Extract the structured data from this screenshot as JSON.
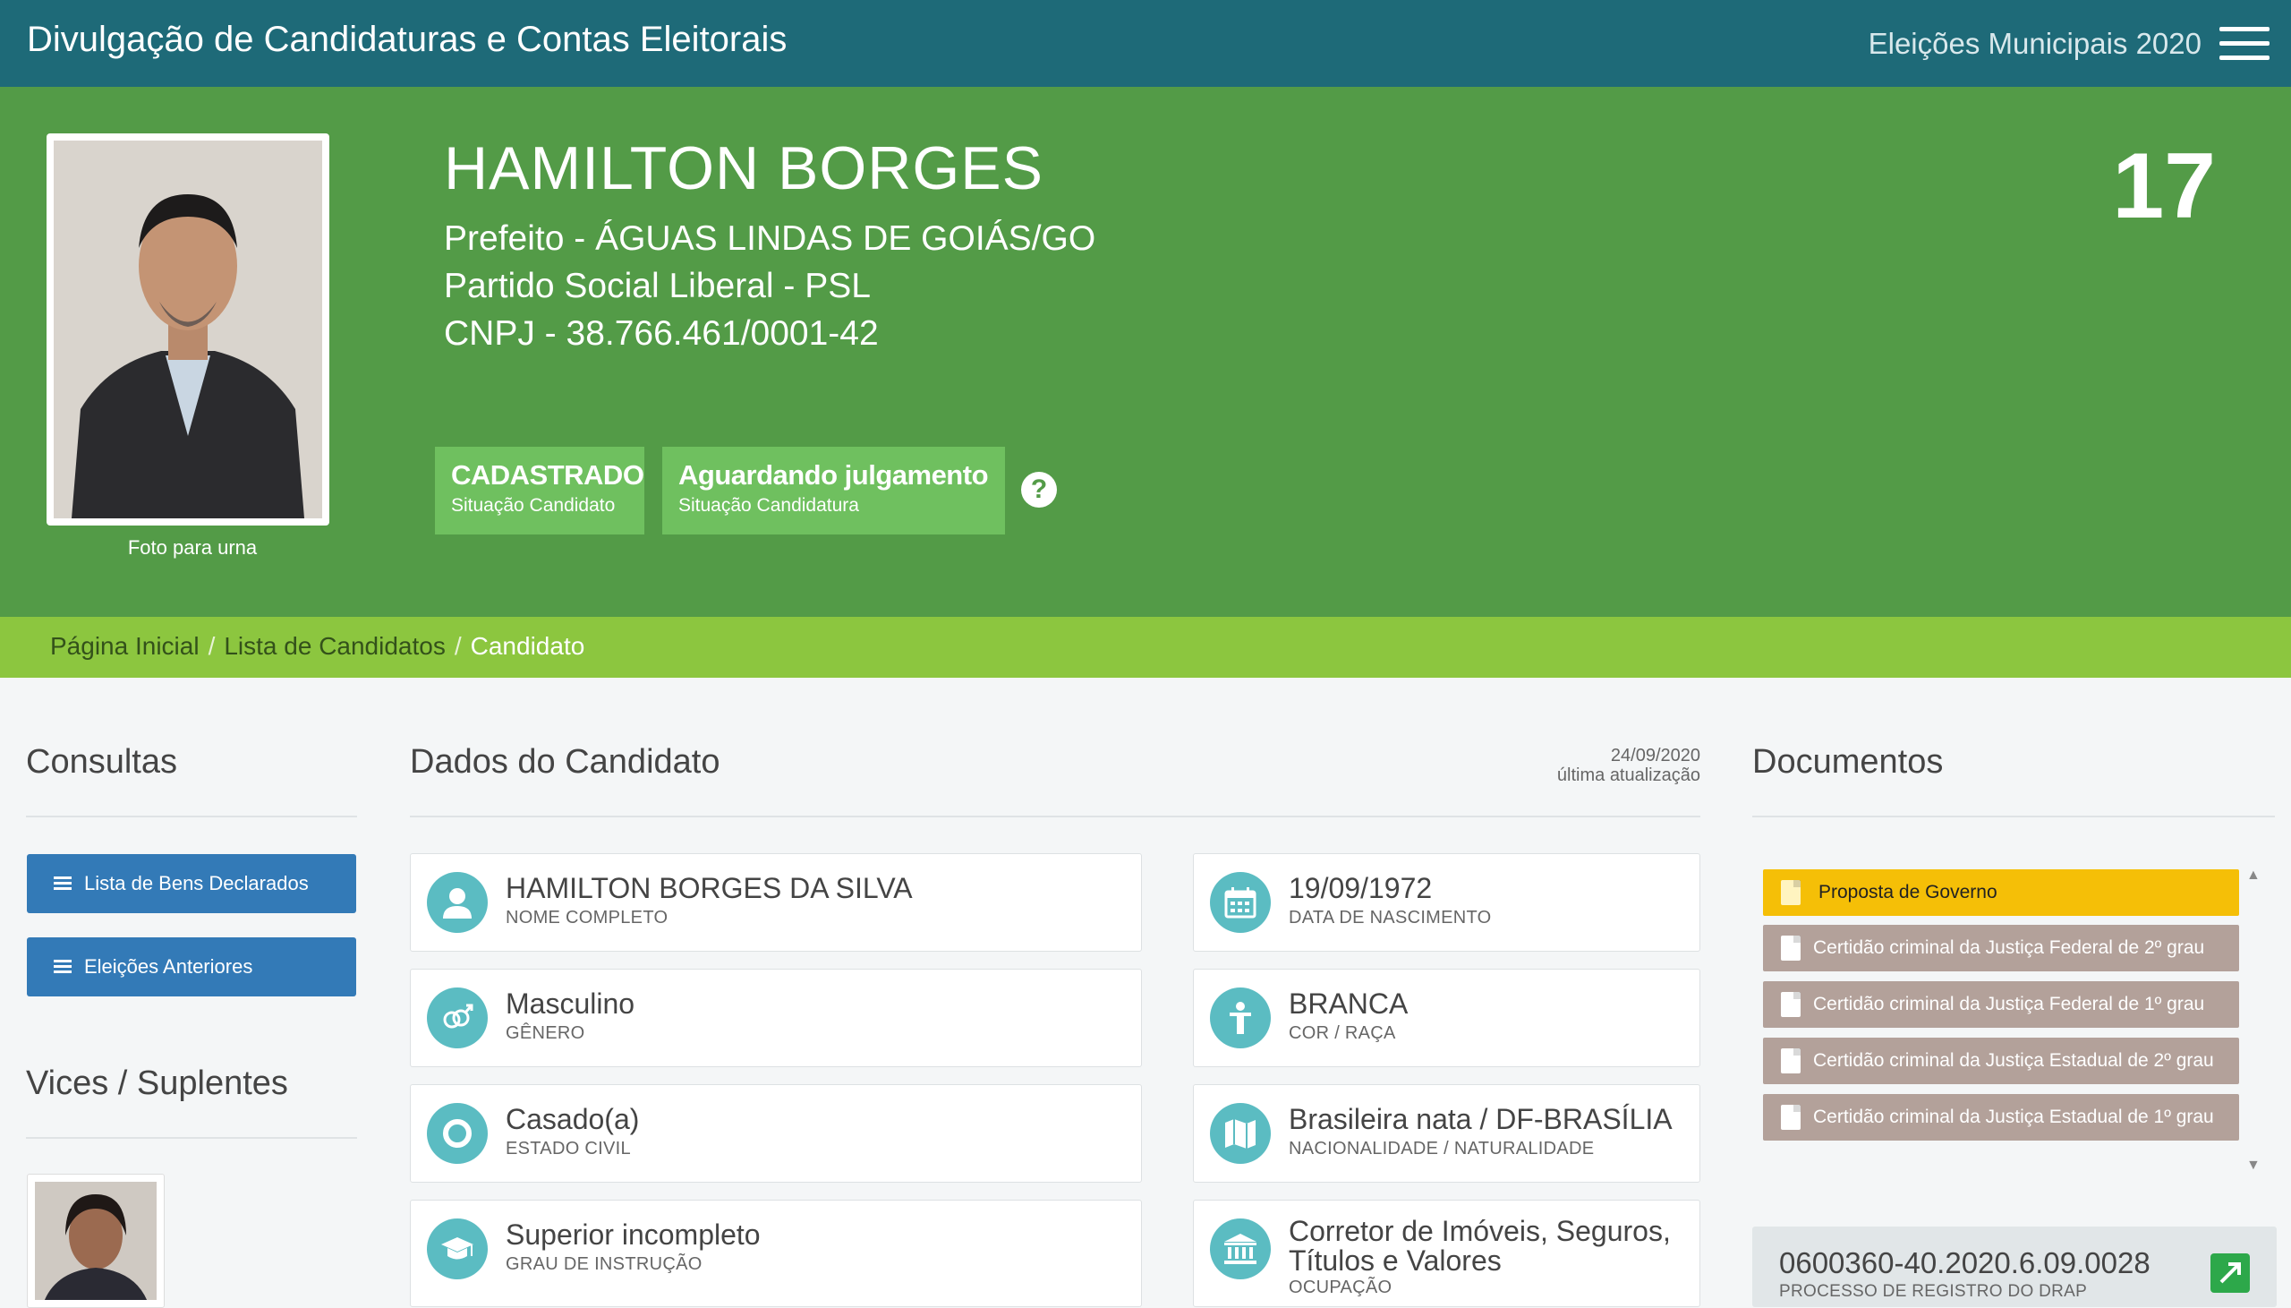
{
  "topbar": {
    "title": "Divulgação de Candidaturas e Contas Eleitorais",
    "election": "Eleições Municipais 2020"
  },
  "hero": {
    "photo_caption": "Foto para urna",
    "name": "HAMILTON BORGES",
    "office": "Prefeito - ÁGUAS LINDAS DE GOIÁS/GO",
    "party": "Partido Social Liberal - PSL",
    "cnpj": "CNPJ - 38.766.461/0001-42",
    "number": "17",
    "status_candidate": {
      "value": "CADASTRADO",
      "label": "Situação Candidato"
    },
    "status_candidacy": {
      "value": "Aguardando julgamento",
      "label": "Situação Candidatura"
    },
    "help": "?"
  },
  "breadcrumb": {
    "home": "Página Inicial",
    "list": "Lista de Candidatos",
    "current": "Candidato",
    "separator": "/"
  },
  "consultas": {
    "title": "Consultas",
    "buttons": [
      "Lista de Bens Declarados",
      "Eleições Anteriores"
    ]
  },
  "vices": {
    "title": "Vices / Suplentes"
  },
  "dados": {
    "title": "Dados do Candidato",
    "update_date": "24/09/2020",
    "update_label": "última atualização",
    "fields": [
      {
        "value": "HAMILTON BORGES DA SILVA",
        "label": "NOME COMPLETO",
        "icon": "user-icon"
      },
      {
        "value": "19/09/1972",
        "label": "DATA DE NASCIMENTO",
        "icon": "calendar-icon"
      },
      {
        "value": "Masculino",
        "label": "GÊNERO",
        "icon": "gender-icon"
      },
      {
        "value": "BRANCA",
        "label": "COR / RAÇA",
        "icon": "person-icon"
      },
      {
        "value": "Casado(a)",
        "label": "ESTADO CIVIL",
        "icon": "ring-icon"
      },
      {
        "value": "Brasileira nata / DF-BRASÍLIA",
        "label": "NACIONALIDADE / NATURALIDADE",
        "icon": "map-icon"
      },
      {
        "value": "Superior incompleto",
        "label": "GRAU DE INSTRUÇÃO",
        "icon": "graduation-cap-icon"
      },
      {
        "value": "Corretor de Imóveis, Seguros, Títulos e Valores",
        "label": "OCUPAÇÃO",
        "icon": "bank-icon"
      }
    ]
  },
  "documentos": {
    "title": "Documentos",
    "items": [
      "Proposta de Governo",
      "Certidão criminal da Justiça Federal de 2º grau",
      "Certidão criminal da Justiça Federal de 1º grau",
      "Certidão criminal da Justiça Estadual de 2º grau",
      "Certidão criminal da Justiça Estadual de 1º grau"
    ],
    "colors": {
      "primary": "#f5bf07",
      "secondary": "#b3a19a"
    }
  },
  "process": {
    "number": "0600360-40.2020.6.09.0028",
    "label": "PROCESSO DE REGISTRO DO DRAP"
  },
  "colors": {
    "topbar": "#1e6a78",
    "hero": "#539b47",
    "breadcrumb": "#8cc63f",
    "button": "#337ab7",
    "icon": "#5bbcc2"
  }
}
